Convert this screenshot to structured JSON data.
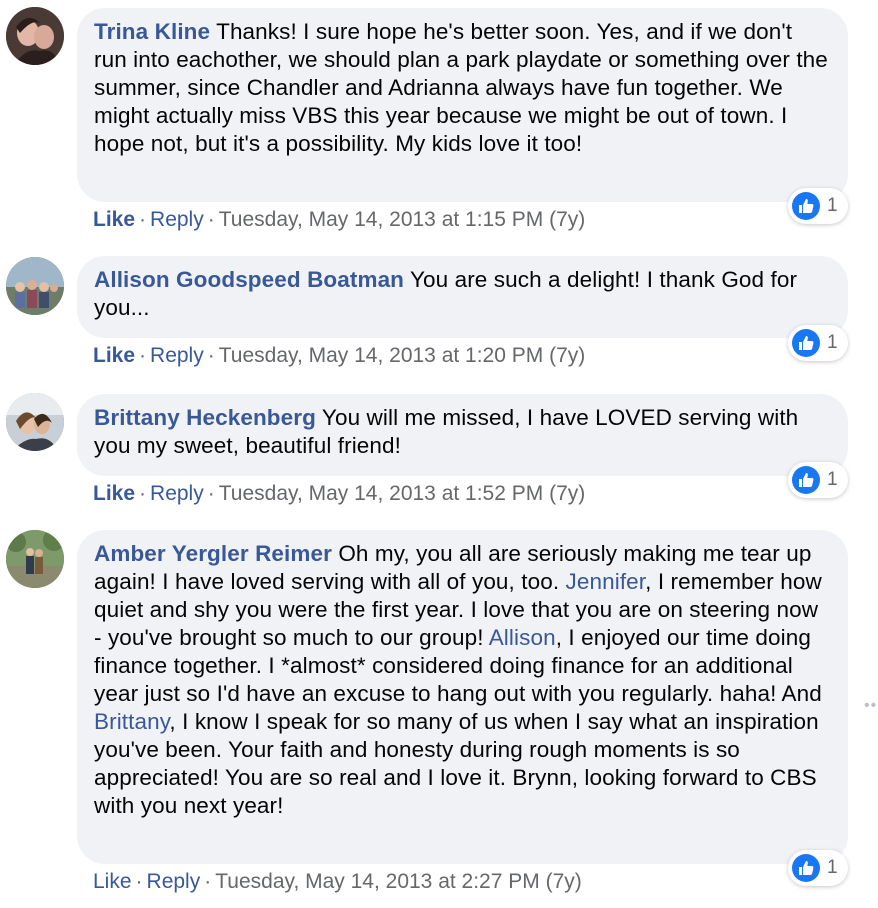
{
  "comments": [
    {
      "author": "Trina Kline",
      "text": "Thanks! I sure hope he's better soon. Yes, and if we don't run into eachother, we should plan a park playdate or something over the summer, since Chandler and Adrianna always have fun together. We might actually miss VBS this year because we might be out of town. I hope not, but it's a possibility. My kids love it too!",
      "like_label": "Like",
      "reply_label": "Reply",
      "separator": "·",
      "timestamp": "Tuesday, May 14, 2013 at 1:15 PM (7y)",
      "reaction_count": "1"
    },
    {
      "author": "Allison Goodspeed Boatman",
      "text": "You are such a delight! I thank God for you...",
      "like_label": "Like",
      "reply_label": "Reply",
      "separator": "·",
      "timestamp": "Tuesday, May 14, 2013 at 1:20 PM (7y)",
      "reaction_count": "1"
    },
    {
      "author": "Brittany Heckenberg",
      "text": "You will me missed, I have LOVED serving with you my sweet, beautiful friend!",
      "like_label": "Like",
      "reply_label": "Reply",
      "separator": "·",
      "timestamp": "Tuesday, May 14, 2013 at 1:52 PM (7y)",
      "reaction_count": "1"
    },
    {
      "author": "Amber Yergler Reimer",
      "text_segments": [
        "Oh my, you all are seriously making me tear up again! I have loved serving with all of you, too.",
        "Jennifer",
        ", I remember how quiet and shy you were the first year. I love that you are on steering now - you've brought so much to our group!",
        "Allison",
        ", I enjoyed our time doing finance together. I *almost* considered doing finance for an additional year just so I'd have an excuse to hang out with you regularly. haha! And",
        "Brittany",
        ", I know I speak for so many of us when I say what an inspiration you've been. Your faith and honesty during rough moments is so appreciated! You are so real and I love it. Brynn, looking forward to CBS with you next year!"
      ],
      "like_label": "Like",
      "reply_label": "Reply",
      "separator": "·",
      "timestamp": "Tuesday, May 14, 2013 at 2:27 PM (7y)",
      "reaction_count": "1"
    }
  ],
  "more_glyph": "••",
  "colors": {
    "author_link": "#385898",
    "bubble_bg": "#f0f2f5",
    "meta_gray": "#65676b",
    "like_blue": "#1877f2"
  },
  "icons": {
    "reaction": "like-thumb-icon",
    "more": "more-options-icon"
  }
}
